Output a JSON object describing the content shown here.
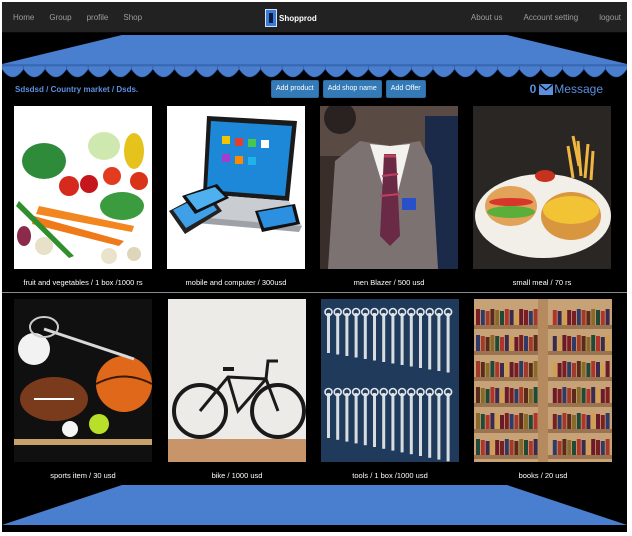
{
  "navbar": {
    "left_links": [
      "Home",
      "Group",
      "profile",
      "Shop"
    ],
    "brand": {
      "text": "Shopprod",
      "icon": "shop-logo-icon"
    },
    "right_links": [
      "About us",
      "Account setting",
      "logout"
    ]
  },
  "toolbar": {
    "breadcrumb": "Sdsdsd / Country market / Dsds.",
    "buttons": [
      "Add product",
      "Add shop name",
      "Add Offer"
    ],
    "message_count": "0",
    "message_label": "Message",
    "message_icon": "envelope-icon"
  },
  "colors": {
    "background": "#000000",
    "navbar": "#222222",
    "awning": "#4a7fd0",
    "accent_text": "#5b8fe0",
    "button": "#337ab7"
  },
  "products": [
    {
      "caption": "fruit and vegetables  / 1 box /1000 rs",
      "icon": "vegetables-photo"
    },
    {
      "caption": "mobile and computer  / 300usd",
      "icon": "laptop-phones-photo"
    },
    {
      "caption": "men Blazer  / 500 usd",
      "icon": "blazer-suit-photo"
    },
    {
      "caption": "small meal  / 70 rs",
      "icon": "burger-fries-photo"
    },
    {
      "caption": "sports item  / 30 usd",
      "icon": "sports-balls-photo"
    },
    {
      "caption": "bike  / 1000 usd",
      "icon": "bicycle-photo"
    },
    {
      "caption": "tools  / 1 box /1000 usd",
      "icon": "wrenches-photo"
    },
    {
      "caption": "books  / 20 usd",
      "icon": "bookshelf-photo"
    }
  ]
}
